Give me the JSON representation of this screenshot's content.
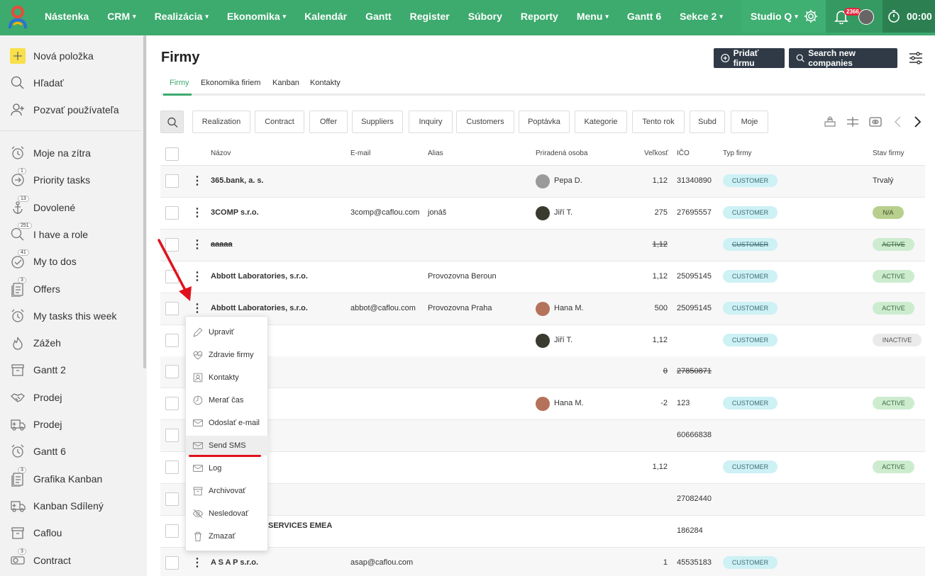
{
  "topbar": {
    "nav": [
      {
        "label": "Nástenka",
        "chev": false
      },
      {
        "label": "CRM",
        "chev": true
      },
      {
        "label": "Realizácia",
        "chev": true
      },
      {
        "label": "Ekonomika",
        "chev": true
      },
      {
        "label": "Kalendár",
        "chev": false
      },
      {
        "label": "Gantt",
        "chev": false
      },
      {
        "label": "Register",
        "chev": false
      },
      {
        "label": "Súbory",
        "chev": false
      },
      {
        "label": "Reporty",
        "chev": false
      },
      {
        "label": "Menu",
        "chev": true
      },
      {
        "label": "Gantt 6",
        "chev": false
      },
      {
        "label": "Sekce 2",
        "chev": true
      },
      {
        "label": "",
        "chev": true
      }
    ],
    "studio": "Studio Q",
    "notif_count": "2366",
    "timer": "00:00",
    "colors": {
      "bar": "#3daa6e",
      "accent": "#3daa6e"
    }
  },
  "sidebar": {
    "top": [
      {
        "label": "Nová položka",
        "icon": "plus-icon"
      },
      {
        "label": "Hľadať",
        "icon": "search-icon"
      },
      {
        "label": "Pozvať používateľa",
        "icon": "invite-user-icon"
      }
    ],
    "items": [
      {
        "label": "Moje na zítra",
        "icon": "alarm-icon",
        "badge": ""
      },
      {
        "label": "Priority tasks",
        "icon": "arrow-circle-icon",
        "badge": "1"
      },
      {
        "label": "Dovolené",
        "icon": "anchor-icon",
        "badge": "13"
      },
      {
        "label": "I have a role",
        "icon": "search-icon",
        "badge": "251"
      },
      {
        "label": "My to dos",
        "icon": "check-circle-icon",
        "badge": "41"
      },
      {
        "label": "Offers",
        "icon": "document-icon",
        "badge": "3"
      },
      {
        "label": "My tasks this week",
        "icon": "alarm-icon",
        "badge": ""
      },
      {
        "label": "Zážeh",
        "icon": "flame-icon",
        "badge": ""
      },
      {
        "label": "Gantt 2",
        "icon": "archive-icon",
        "badge": ""
      },
      {
        "label": "Prodej",
        "icon": "handshake-icon",
        "badge": ""
      },
      {
        "label": "Prodej",
        "icon": "truck-icon",
        "badge": ""
      },
      {
        "label": "Gantt 6",
        "icon": "alarm-icon",
        "badge": ""
      },
      {
        "label": "Grafika Kanban",
        "icon": "document-icon",
        "badge": "3"
      },
      {
        "label": "Kanban Sdílený",
        "icon": "truck-icon",
        "badge": ""
      },
      {
        "label": "Caflou",
        "icon": "archive-icon",
        "badge": ""
      },
      {
        "label": "Contract",
        "icon": "toggle-icon",
        "badge": "3"
      }
    ]
  },
  "page": {
    "title": "Firmy",
    "add_button": "Pridať firmu",
    "search_button": "Search new companies",
    "tabs": [
      "Firmy",
      "Ekonomika firiem",
      "Kanban",
      "Kontakty"
    ],
    "chips": [
      "Realization",
      "Contract",
      "Offer",
      "Suppliers",
      "Inquiry",
      "Customers",
      "Poptávka",
      "Kategorie",
      "Tento rok",
      "Subd",
      "Moje"
    ]
  },
  "table": {
    "headers": {
      "name": "Názov",
      "email": "E-mail",
      "alias": "Alias",
      "person": "Priradená osoba",
      "size": "Veľkosť",
      "ico": "IČO",
      "type": "Typ firmy",
      "state": "Stav firmy"
    },
    "rows": [
      {
        "name": "365.bank, a. s.",
        "email": "",
        "alias": "",
        "person": "Pepa D.",
        "avatar": "gray",
        "size": "1,12",
        "ico": "31340890",
        "type": "CUSTOMER",
        "state": "Trvalý",
        "state_style": "text",
        "strike": false,
        "alt": true
      },
      {
        "name": "3COMP s.r.o.",
        "email": "3comp@caflou.com",
        "alias": "jonáš",
        "person": "Jiří T.",
        "avatar": "dark",
        "size": "275",
        "ico": "27695557",
        "type": "CUSTOMER",
        "state": "N/A",
        "state_style": "na",
        "strike": false,
        "alt": false
      },
      {
        "name": "aaaaa",
        "email": "",
        "alias": "",
        "person": "",
        "avatar": "",
        "size": "1,12",
        "ico": "",
        "type": "CUSTOMER",
        "state": "ACTIVE",
        "state_style": "active",
        "strike": true,
        "alt": true
      },
      {
        "name": "Abbott Laboratories, s.r.o.",
        "email": "",
        "alias": "Provozovna Beroun",
        "person": "",
        "avatar": "",
        "size": "1,12",
        "ico": "25095145",
        "type": "CUSTOMER",
        "state": "ACTIVE",
        "state_style": "active",
        "strike": false,
        "alt": false
      },
      {
        "name": "Abbott Laboratories, s.r.o.",
        "email": "abbot@caflou.com",
        "alias": "Provozovna Praha",
        "person": "Hana M.",
        "avatar": "red",
        "size": "500",
        "ico": "25095145",
        "type": "CUSTOMER",
        "state": "ACTIVE",
        "state_style": "active",
        "strike": false,
        "alt": true
      },
      {
        "name": "",
        "email": "",
        "alias": "",
        "person": "Jiří T.",
        "avatar": "dark",
        "size": "1,12",
        "ico": "",
        "type": "CUSTOMER",
        "state": "INACTIVE",
        "state_style": "inactive",
        "strike": false,
        "alt": false
      },
      {
        "name": "",
        "email": "",
        "alias": "",
        "person": "",
        "avatar": "",
        "size": "0",
        "ico": "27850871",
        "type": "",
        "state": "",
        "state_style": "",
        "strike": true,
        "alt": true
      },
      {
        "name": "",
        "email": "",
        "alias": "",
        "person": "Hana M.",
        "avatar": "red",
        "size": "-2",
        "ico": "123",
        "type": "CUSTOMER",
        "state": "ACTIVE",
        "state_style": "active",
        "strike": false,
        "alt": false
      },
      {
        "name": "",
        "email": "",
        "alias": "",
        "person": "",
        "avatar": "",
        "size": "",
        "ico": "60666838",
        "type": "",
        "state": "",
        "state_style": "",
        "strike": false,
        "alt": true
      },
      {
        "name": "",
        "email": "",
        "alias": "",
        "person": "",
        "avatar": "",
        "size": "1,12",
        "ico": "",
        "type": "CUSTOMER",
        "state": "ACTIVE",
        "state_style": "active",
        "strike": false,
        "alt": false
      },
      {
        "name": "",
        "email": "",
        "alias": "",
        "person": "",
        "avatar": "",
        "size": "",
        "ico": "27082440",
        "type": "",
        "state": "",
        "state_style": "",
        "strike": false,
        "alt": true
      },
      {
        "name": "SERVICES EMEA",
        "email": "",
        "alias": "",
        "person": "",
        "avatar": "",
        "size": "",
        "ico": "186284",
        "type": "",
        "state": "",
        "state_style": "",
        "strike": false,
        "alt": false
      },
      {
        "name": "A S A P s.r.o.",
        "email": "asap@caflou.com",
        "alias": "",
        "person": "",
        "avatar": "",
        "size": "1",
        "ico": "45535183",
        "type": "CUSTOMER",
        "state": "",
        "state_style": "",
        "strike": false,
        "alt": true
      }
    ]
  },
  "context_menu": {
    "items": [
      {
        "label": "Upraviť",
        "icon": "pencil-icon"
      },
      {
        "label": "Zdravie firmy",
        "icon": "heart-pulse-icon"
      },
      {
        "label": "Kontakty",
        "icon": "contact-card-icon"
      },
      {
        "label": "Merať čas",
        "icon": "timer-icon"
      },
      {
        "label": "Odoslať e-mail",
        "icon": "mail-icon"
      },
      {
        "label": "Send SMS",
        "icon": "mail-icon"
      },
      {
        "label": "Log",
        "icon": "mail-icon"
      },
      {
        "label": "Archivovať",
        "icon": "archive-icon"
      },
      {
        "label": "Nesledovať",
        "icon": "eye-off-icon"
      },
      {
        "label": "Zmazať",
        "icon": "trash-icon"
      }
    ],
    "highlighted": "Send SMS"
  }
}
